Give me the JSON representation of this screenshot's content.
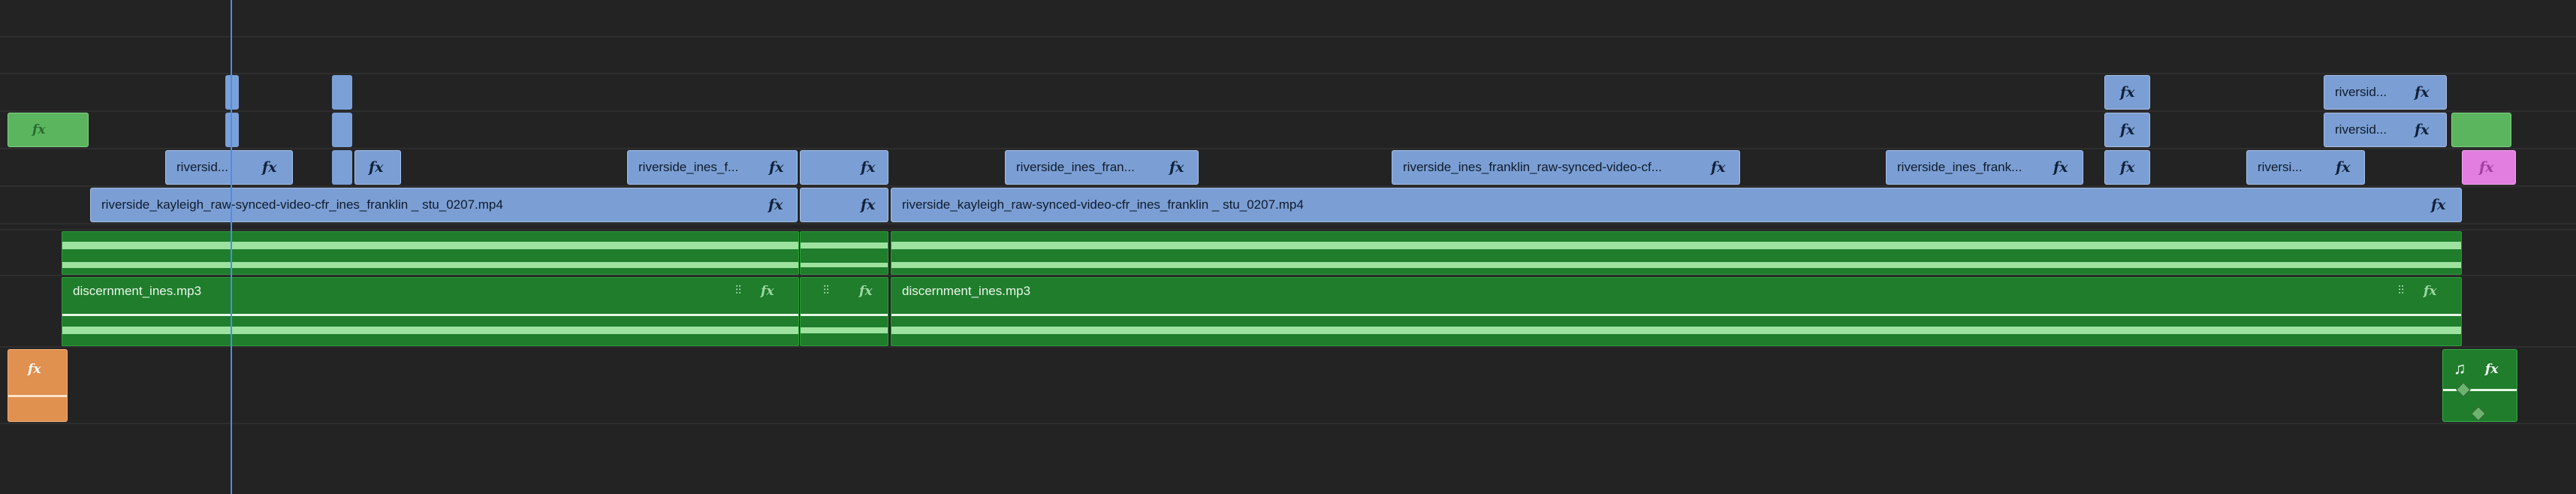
{
  "timeline": {
    "video_clips": [
      {
        "id": "v1-left",
        "label": "riversid...",
        "fx": "fx"
      },
      {
        "id": "v1-ines-f",
        "label": "riverside_ines_f...",
        "fx": "fx"
      },
      {
        "id": "v1-ines-fran",
        "label": "riverside_ines_fran...",
        "fx": "fx"
      },
      {
        "id": "v1-ines-franklin-raw",
        "label": "riverside_ines_franklin_raw-synced-video-cf...",
        "fx": "fx"
      },
      {
        "id": "v1-ines-frank",
        "label": "riverside_ines_frank...",
        "fx": "fx"
      },
      {
        "id": "v1-riversi",
        "label": "riversi...",
        "fx": "fx"
      },
      {
        "id": "v3-riversid-top",
        "label": "riversid...",
        "fx": "fx"
      },
      {
        "id": "v2-riversid",
        "label": "riversid...",
        "fx": "fx"
      },
      {
        "id": "kayleigh-1",
        "label": "riverside_kayleigh_raw-synced-video-cfr_ines_franklin _ stu_0207.mp4",
        "fx": "fx"
      },
      {
        "id": "kayleigh-2",
        "label": "riverside_kayleigh_raw-synced-video-cfr_ines_franklin _ stu_0207.mp4",
        "fx": "fx"
      }
    ],
    "audio_clips": [
      {
        "id": "a1",
        "label": "discernment_ines.mp3",
        "fx": "fx"
      },
      {
        "id": "a2",
        "label": "discernment_ines.mp3",
        "fx": "fx"
      }
    ],
    "fx_label": "fx",
    "colors": {
      "background": "#232323",
      "video_clip": "#7b9fd4",
      "audio_clip": "#1f7d2c",
      "waveform": "#9de39f",
      "playhead": "#4a8fe8",
      "green_clip": "#5bb55f",
      "pink_clip": "#e27ee0",
      "orange_clip": "#e0904f"
    }
  }
}
